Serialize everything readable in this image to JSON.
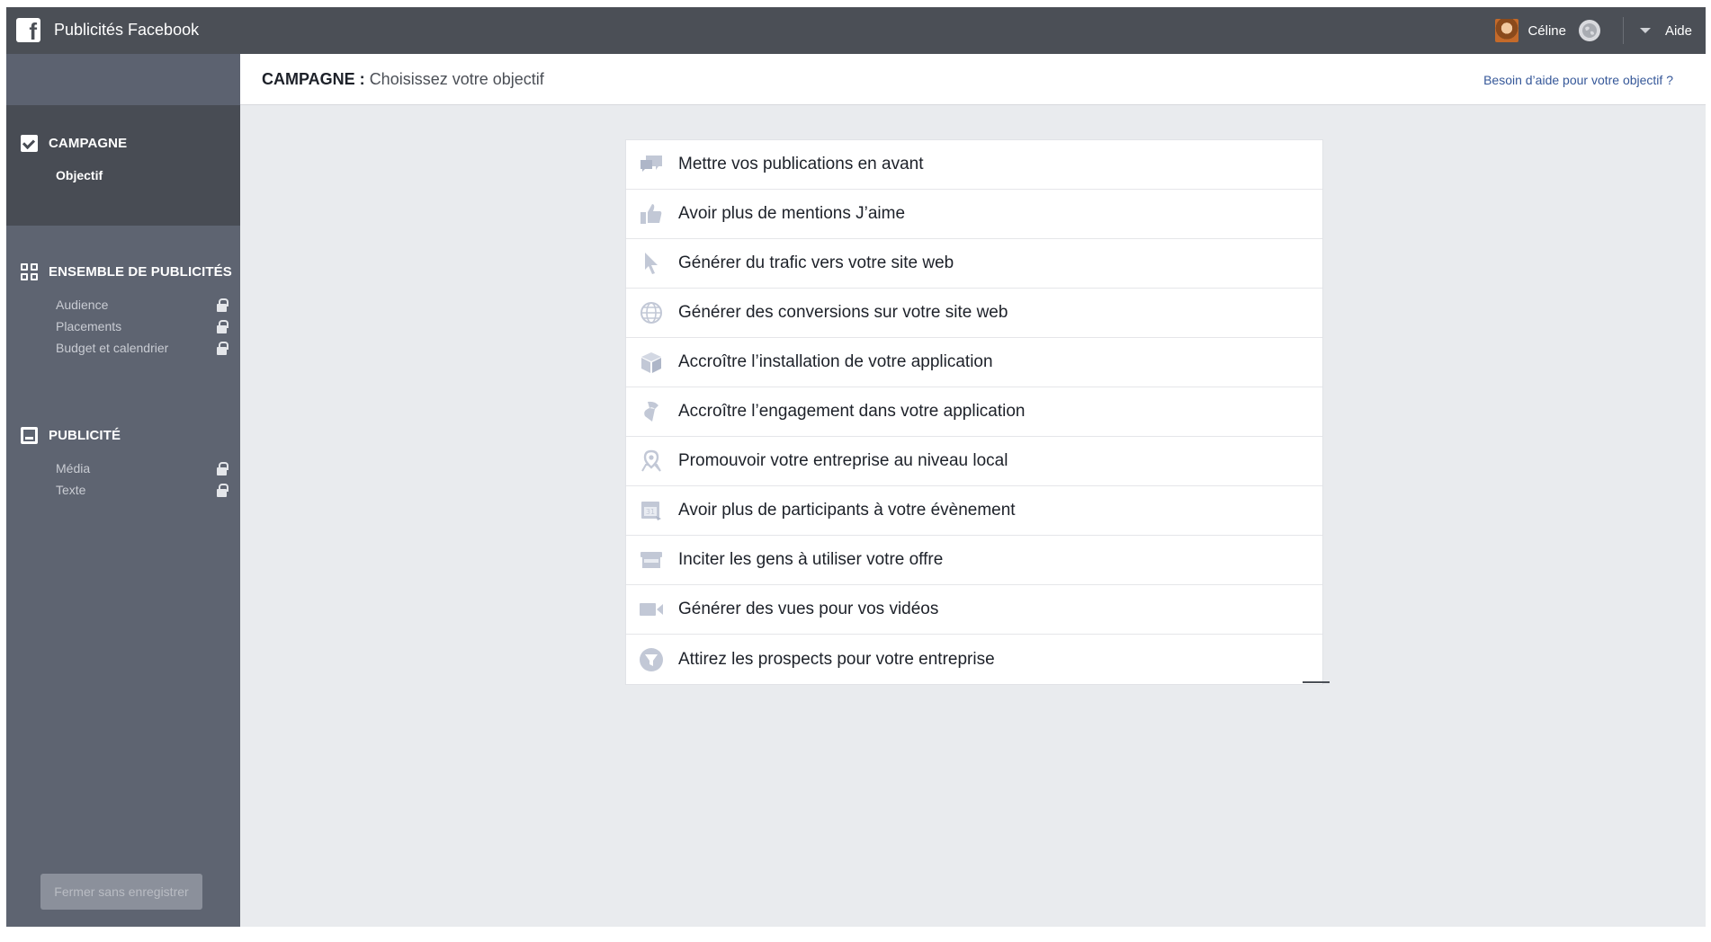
{
  "topbar": {
    "title": "Publicités Facebook",
    "logo_letter": "f",
    "user_name": "Céline",
    "help": "Aide"
  },
  "header": {
    "title_strong": "CAMPAGNE :",
    "title_rest": "Choisissez votre objectif",
    "help_link": "Besoin d’aide pour votre objectif ?"
  },
  "sidebar": {
    "sections": [
      {
        "label": "CAMPAGNE",
        "items": [
          {
            "label": "Objectif",
            "locked": false
          }
        ]
      },
      {
        "label": "ENSEMBLE DE PUBLICITÉS",
        "items": [
          {
            "label": "Audience",
            "locked": true
          },
          {
            "label": "Placements",
            "locked": true
          },
          {
            "label": "Budget et calendrier",
            "locked": true
          }
        ]
      },
      {
        "label": "PUBLICITÉ",
        "items": [
          {
            "label": "Média",
            "locked": true
          },
          {
            "label": "Texte",
            "locked": true
          }
        ]
      }
    ],
    "close_button": "Fermer sans enregistrer"
  },
  "objectives": [
    {
      "label": "Mettre vos publications en avant",
      "icon": "speech-bubbles-icon"
    },
    {
      "label": "Avoir plus de mentions J’aime",
      "icon": "thumbs-up-icon"
    },
    {
      "label": "Générer du trafic vers votre site web",
      "icon": "cursor-icon"
    },
    {
      "label": "Générer des conversions sur votre site web",
      "icon": "globe-icon"
    },
    {
      "label": "Accroître l’installation de votre application",
      "icon": "box-icon"
    },
    {
      "label": "Accroître l’engagement dans votre application",
      "icon": "game-controller-icon"
    },
    {
      "label": "Promouvoir votre entreprise au niveau local",
      "icon": "map-pin-icon"
    },
    {
      "label": "Avoir plus de participants à votre évènement",
      "icon": "calendar-icon"
    },
    {
      "label": "Inciter les gens à utiliser votre offre",
      "icon": "storefront-icon"
    },
    {
      "label": "Générer des vues pour vos vidéos",
      "icon": "video-camera-icon"
    },
    {
      "label": "Attirez les prospects pour votre entreprise",
      "icon": "funnel-icon"
    }
  ],
  "colors": {
    "topbar": "#4b4f56",
    "sidebar": "#5e6471",
    "sidebar_active": "#484c54",
    "link": "#365899",
    "icon": "#c2c8d6"
  }
}
